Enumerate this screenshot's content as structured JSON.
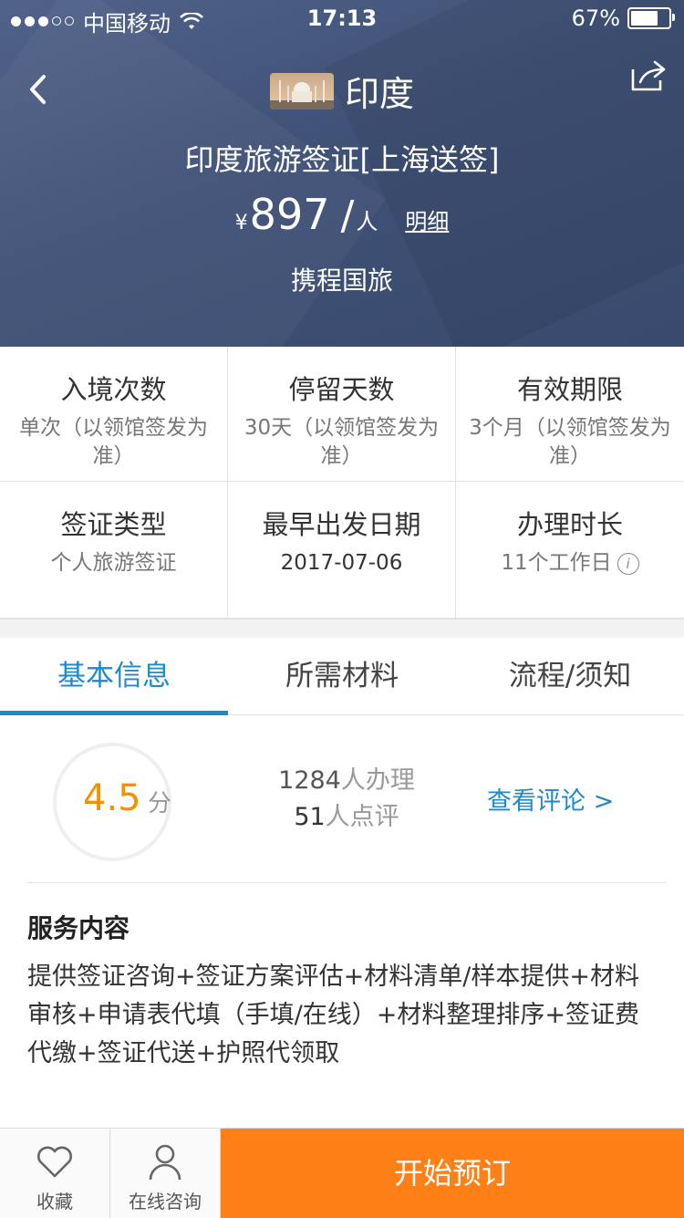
{
  "status_bar": {
    "carrier": "中国移动",
    "time": "17:13",
    "battery": "67%",
    "battery_level": 0.67
  },
  "header": {
    "country": "印度",
    "product_title": "印度旅游签证[上海送签]",
    "price_currency": "¥",
    "price_value": "897",
    "price_slash": "/",
    "price_unit": "人",
    "detail_link": "明细",
    "supplier": "携程国旅"
  },
  "info_grid": [
    {
      "label": "入境次数",
      "value": "单次（以领馆签发为准）"
    },
    {
      "label": "停留天数",
      "value": "30天（以领馆签发为准）"
    },
    {
      "label": "有效期限",
      "value": "3个月（以领馆签发为准）"
    },
    {
      "label": "签证类型",
      "value": "个人旅游签证"
    },
    {
      "label": "最早出发日期",
      "value": "2017-07-06"
    },
    {
      "label": "办理时长",
      "value": "11个工作日"
    }
  ],
  "tabs": [
    {
      "label": "基本信息",
      "active": true
    },
    {
      "label": "所需材料",
      "active": false
    },
    {
      "label": "流程/须知",
      "active": false
    }
  ],
  "rating": {
    "score": "4.5",
    "unit": "分",
    "applicants_num": "1284",
    "applicants_text": "人办理",
    "reviews_num": "51",
    "reviews_text": "人点评",
    "view_reviews": "查看评论 >"
  },
  "service": {
    "title": "服务内容",
    "body": "提供签证咨询+签证方案评估+材料清单/样本提供+材料审核+申请表代填（手填/在线）+材料整理排序+签证费代缴+签证代送+护照代领取"
  },
  "bottom_bar": {
    "favorite": "收藏",
    "consult": "在线咨询",
    "book": "开始预订"
  },
  "colors": {
    "header_bg": "#3f5176",
    "accent_blue": "#1f8ac7",
    "score_orange": "#f39200",
    "book_orange": "#ff8017"
  },
  "icons": [
    "back-chevron-icon",
    "share-icon",
    "wifi-icon",
    "heart-icon",
    "person-icon",
    "info-icon"
  ]
}
